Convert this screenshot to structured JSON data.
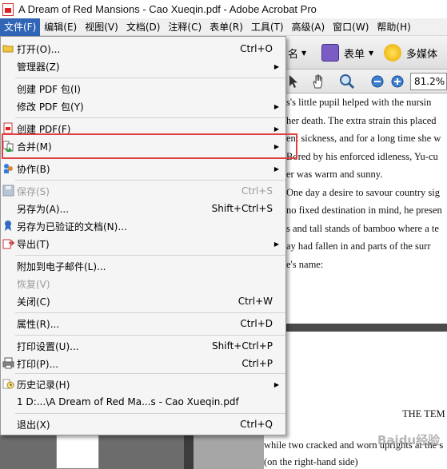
{
  "window": {
    "title": "A Dream of Red Mansions - Cao Xueqin.pdf - Adobe Acrobat Pro"
  },
  "menubar": [
    "文件(F)",
    "编辑(E)",
    "视图(V)",
    "文档(D)",
    "注释(C)",
    "表单(R)",
    "工具(T)",
    "高级(A)",
    "窗口(W)",
    "帮助(H)"
  ],
  "toolbar": {
    "sign_label": "名",
    "form_label": "表单",
    "multimedia_label": "多媒体",
    "zoom": "81.2%"
  },
  "file_menu": {
    "items": [
      {
        "label": "打开(O)...",
        "shortcut": "Ctrl+O",
        "submenu": false,
        "disabled": false,
        "icon": "folder-open-icon"
      },
      {
        "label": "管理器(Z)",
        "shortcut": "",
        "submenu": true,
        "disabled": false,
        "icon": ""
      },
      {
        "label": "创建 PDF 包(I)",
        "shortcut": "",
        "submenu": false,
        "disabled": false,
        "icon": ""
      },
      {
        "label": "修改 PDF 包(Y)",
        "shortcut": "",
        "submenu": true,
        "disabled": false,
        "icon": ""
      },
      {
        "label": "创建 PDF(F)",
        "shortcut": "",
        "submenu": true,
        "disabled": false,
        "icon": "create-pdf-icon"
      },
      {
        "label": "合并(M)",
        "shortcut": "",
        "submenu": true,
        "disabled": false,
        "icon": "combine-icon"
      },
      {
        "label": "协作(B)",
        "shortcut": "",
        "submenu": true,
        "disabled": false,
        "icon": "collaborate-icon"
      },
      {
        "label": "保存(S)",
        "shortcut": "Ctrl+S",
        "submenu": false,
        "disabled": true,
        "icon": "save-icon"
      },
      {
        "label": "另存为(A)...",
        "shortcut": "Shift+Ctrl+S",
        "submenu": false,
        "disabled": false,
        "icon": ""
      },
      {
        "label": "另存为已验证的文档(N)...",
        "shortcut": "",
        "submenu": false,
        "disabled": false,
        "icon": "certified-document-icon"
      },
      {
        "label": "导出(T)",
        "shortcut": "",
        "submenu": true,
        "disabled": false,
        "icon": "export-icon"
      },
      {
        "label": "附加到电子邮件(L)...",
        "shortcut": "",
        "submenu": false,
        "disabled": false,
        "icon": ""
      },
      {
        "label": "恢复(V)",
        "shortcut": "",
        "submenu": false,
        "disabled": true,
        "icon": ""
      },
      {
        "label": "关闭(C)",
        "shortcut": "Ctrl+W",
        "submenu": false,
        "disabled": false,
        "icon": ""
      },
      {
        "label": "属性(R)...",
        "shortcut": "Ctrl+D",
        "submenu": false,
        "disabled": false,
        "icon": ""
      },
      {
        "label": "打印设置(U)...",
        "shortcut": "Shift+Ctrl+P",
        "submenu": false,
        "disabled": false,
        "icon": ""
      },
      {
        "label": "打印(P)...",
        "shortcut": "Ctrl+P",
        "submenu": false,
        "disabled": false,
        "icon": "printer-icon"
      },
      {
        "label": "历史记录(H)",
        "shortcut": "",
        "submenu": true,
        "disabled": false,
        "icon": "history-icon"
      },
      {
        "label": "1 D:...\\A Dream of Red Ma...s - Cao Xueqin.pdf",
        "shortcut": "",
        "submenu": false,
        "disabled": false,
        "icon": ""
      },
      {
        "label": "退出(X)",
        "shortcut": "Ctrl+Q",
        "submenu": false,
        "disabled": false,
        "icon": ""
      }
    ]
  },
  "document": {
    "page1_lines": [
      "s's little pupil helped with the nursin",
      "her death. The extra strain this placed",
      "ent sickness, and for a long time she w",
      "Bored by his enforced idleness, Yu-cu",
      "er was warm and sunny.",
      "One day a desire to savour country sig",
      "no fixed destination in mind, he presen",
      "s and tall stands of bamboo where a te",
      "ay had fallen in and parts of the surr",
      "e's name:"
    ],
    "page2_heading": "THE TEM",
    "page2_lines": [
      "while two cracked and worn uprights at the s",
      "(on the right-hand side)"
    ]
  },
  "watermark": "Baidu经验"
}
